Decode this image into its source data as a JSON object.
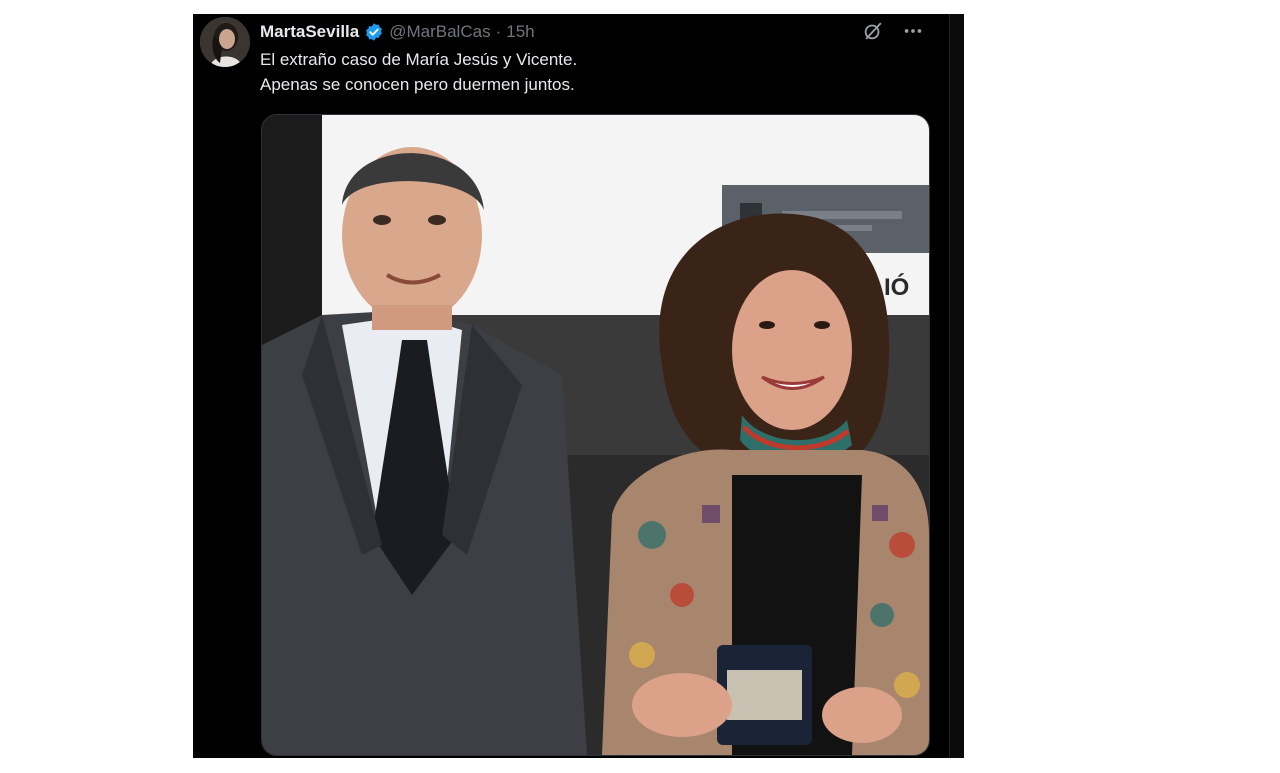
{
  "tweet": {
    "author": {
      "display_name": "MartaSevilla",
      "handle": "@MarBalCas",
      "separator": "·",
      "timestamp": "15h",
      "verified": true
    },
    "text_lines": [
      "El extraño caso de María Jesús y Vicente.",
      "Apenas se conocen pero duermen juntos."
    ],
    "icons": {
      "grok": "grok-icon",
      "more": "more-icon",
      "verified": "verified-badge-icon"
    },
    "media": {
      "kind": "photo",
      "partial_sign_text": "IÓ"
    }
  },
  "colors": {
    "tweet_background": "#000000",
    "primary_text": "#e7e9ea",
    "secondary_text": "#71767b",
    "verified_blue": "#1d9bf0"
  }
}
